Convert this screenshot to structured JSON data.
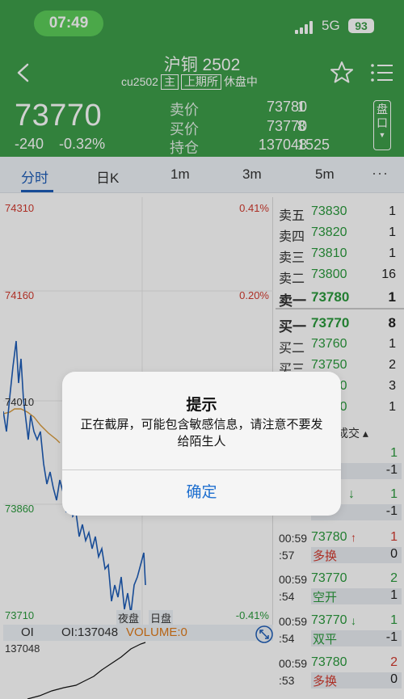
{
  "status": {
    "time": "07:49",
    "network": "5G",
    "battery": "93"
  },
  "header": {
    "title": "沪铜 2502",
    "code": "cu2502",
    "tag_main": "主",
    "exchange": "上期所",
    "state": "休盘中",
    "price": "73770",
    "change": "-240",
    "change_pct": "-0.32%",
    "sell": {
      "label": "卖价",
      "price": "73780",
      "qty": "1"
    },
    "buy": {
      "label": "买价",
      "price": "73770",
      "qty": "8"
    },
    "hold": {
      "label": "持仓",
      "value": "137048",
      "qty": "1525"
    },
    "pan_button": "盘口"
  },
  "tabs": [
    "分时",
    "日K",
    "1m",
    "3m",
    "5m",
    "···"
  ],
  "chart": {
    "y_labels": [
      "74310",
      "74160",
      "74010",
      "73860",
      "73710"
    ],
    "pct_labels": [
      "0.41%",
      "0.20%",
      "-0.41%"
    ],
    "session_labels": [
      "夜盘",
      "日盘"
    ],
    "oi_bar": {
      "oi": "OI",
      "oi_value": "OI:137048",
      "volume": "VOLUME:0"
    },
    "oi_axis": "137048"
  },
  "orderbook": {
    "asks": [
      {
        "label": "卖五",
        "price": "73830",
        "qty": "1"
      },
      {
        "label": "卖四",
        "price": "73820",
        "qty": "1"
      },
      {
        "label": "卖三",
        "price": "73810",
        "qty": "1"
      },
      {
        "label": "卖二",
        "price": "73800",
        "qty": "16"
      },
      {
        "label": "卖一",
        "price": "73780",
        "qty": "1"
      }
    ],
    "bids": [
      {
        "label": "买一",
        "price": "73770",
        "qty": "8"
      },
      {
        "label": "买二",
        "price": "73760",
        "qty": "1"
      },
      {
        "label": "买三",
        "price": "73750",
        "qty": "2"
      },
      {
        "label": "买四",
        "price": "73740",
        "qty": "3"
      },
      {
        "label": "买五",
        "price": "73730",
        "qty": "1"
      }
    ]
  },
  "trades_header": "成交 ▴",
  "trades": [
    {
      "time": "",
      "price": "",
      "arrow": "",
      "qty": "1",
      "sub": "",
      "kind": "",
      "delta": "-1",
      "color": "#2a9a3c"
    },
    {
      "time": "",
      "price": "",
      "arrow": "↓",
      "qty": "1",
      "sub": "",
      "kind": "",
      "delta": "-1",
      "color": "#2a9a3c"
    },
    {
      "time": "00:59",
      "price": "73780",
      "arrow": "↑",
      "qty": "1",
      "sub": ":57",
      "kind": "多换",
      "delta": "0",
      "color": "#d23a2e"
    },
    {
      "time": "00:59",
      "price": "73770",
      "arrow": "",
      "qty": "2",
      "sub": ":54",
      "kind": "空开",
      "delta": "1",
      "color": "#2a9a3c"
    },
    {
      "time": "00:59",
      "price": "73770",
      "arrow": "↓",
      "qty": "1",
      "sub": ":54",
      "kind": "双平",
      "delta": "-1",
      "color": "#2a9a3c"
    },
    {
      "time": "00:59",
      "price": "73780",
      "arrow": "",
      "qty": "2",
      "sub": ":53",
      "kind": "多换",
      "delta": "0",
      "color": "#d23a2e"
    }
  ],
  "dialog": {
    "title": "提示",
    "message": "正在截屏，可能包含敏感信息，请注意不要发给陌生人",
    "ok": "确定"
  },
  "colors": {
    "brand_green": "#3d9e4a",
    "up_red": "#d23a2e",
    "down_green": "#2a9a3c",
    "line_blue": "#1e5db8",
    "avg_orange": "#d89a3a"
  }
}
